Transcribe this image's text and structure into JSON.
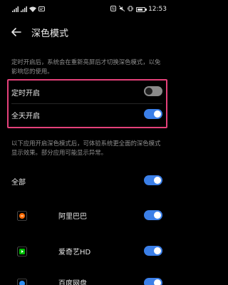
{
  "status_bar": {
    "left_icons": [
      "sim-signal-icon",
      "sim-signal-icon",
      "wifi-icon",
      "message-icon"
    ],
    "right_icons": [
      "nfc-icon",
      "mute-icon",
      "vibrate-icon"
    ],
    "time": "12:53",
    "battery_level": 0.8
  },
  "header": {
    "title": "深色模式"
  },
  "intro_text": "定时开启后，系统会在重新亮屏后才切换深色模式，以免影响您的使用。",
  "settings": [
    {
      "label": "定时开启",
      "enabled": false
    },
    {
      "label": "全天开启",
      "enabled": true
    }
  ],
  "apps_intro": "以下应用开启深色模式后，可体验系统更全面的深色模式显示效果。部分应用可能显示异常。",
  "all_apps": {
    "label": "全部",
    "enabled": true
  },
  "apps": [
    {
      "name": "阿里巴巴",
      "icon": "alibaba-icon",
      "enabled": true
    },
    {
      "name": "爱奇艺HD",
      "icon": "iqiyi-icon",
      "enabled": true
    },
    {
      "name": "百度网盘",
      "icon": "baidu-netdisk-icon",
      "enabled": true
    }
  ],
  "colors": {
    "accent": "#3b7fe8",
    "highlight_border": "#e5417a",
    "background": "#000000"
  }
}
